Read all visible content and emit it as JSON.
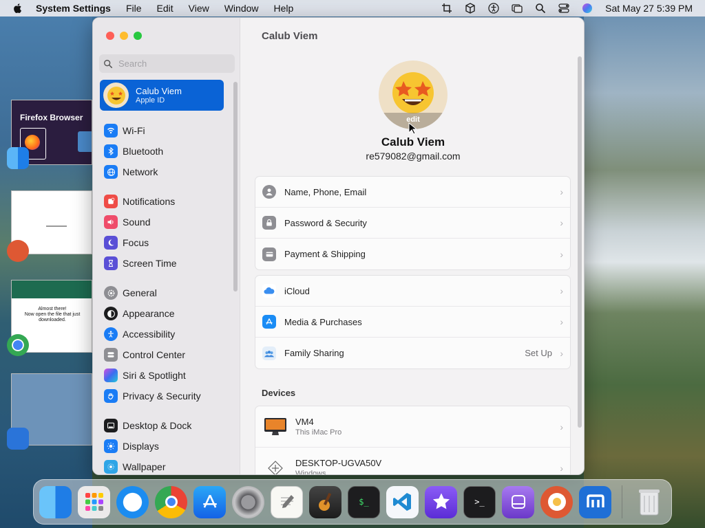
{
  "menubar": {
    "app_name": "System Settings",
    "menus": [
      "File",
      "Edit",
      "View",
      "Window",
      "Help"
    ],
    "clock": "Sat May 27  5:39 PM"
  },
  "desktop_thumbnails": {
    "firefox_title": "Firefox Browser",
    "firefox_msg_1": "Almost there!",
    "firefox_msg_2": "Now open the file that just downloaded."
  },
  "sidebar": {
    "search_placeholder": "Search",
    "account": {
      "name": "Calub Viem",
      "subtitle": "Apple ID"
    },
    "items": [
      {
        "label": "Wi-Fi",
        "color": "#1a7cf5",
        "icon": "wifi-icon"
      },
      {
        "label": "Bluetooth",
        "color": "#1a7cf5",
        "icon": "bluetooth-icon"
      },
      {
        "label": "Network",
        "color": "#1a7cf5",
        "icon": "globe-icon"
      },
      {
        "label": "Notifications",
        "color": "#ef4c47",
        "icon": "bell-icon"
      },
      {
        "label": "Sound",
        "color": "#ef4c6a",
        "icon": "speaker-icon"
      },
      {
        "label": "Focus",
        "color": "#5a4fd6",
        "icon": "moon-icon"
      },
      {
        "label": "Screen Time",
        "color": "#5a4fd6",
        "icon": "hourglass-icon"
      },
      {
        "label": "General",
        "color": "#8e8e93",
        "icon": "gear-icon"
      },
      {
        "label": "Appearance",
        "color": "#1c1c1e",
        "icon": "appearance-icon"
      },
      {
        "label": "Accessibility",
        "color": "#1a7cf5",
        "icon": "accessibility-icon"
      },
      {
        "label": "Control Center",
        "color": "#8e8e93",
        "icon": "control-center-icon"
      },
      {
        "label": "Siri & Spotlight",
        "color": "#9b3ed1",
        "icon": "siri-icon"
      },
      {
        "label": "Privacy & Security",
        "color": "#1a7cf5",
        "icon": "hand-icon"
      },
      {
        "label": "Desktop & Dock",
        "color": "#1c1c1e",
        "icon": "dock-icon"
      },
      {
        "label": "Displays",
        "color": "#1a7cf5",
        "icon": "sun-icon"
      },
      {
        "label": "Wallpaper",
        "color": "#2fa5e6",
        "icon": "wallpaper-icon"
      }
    ]
  },
  "content": {
    "title": "Calub Viem",
    "avatar_edit": "edit",
    "profile_name": "Calub Viem",
    "profile_email": "re579082@gmail.com",
    "group1": [
      {
        "label": "Name, Phone, Email",
        "icon": "person-icon"
      },
      {
        "label": "Password & Security",
        "icon": "lock-icon"
      },
      {
        "label": "Payment & Shipping",
        "icon": "card-icon"
      }
    ],
    "group2": [
      {
        "label": "iCloud",
        "icon": "cloud-icon"
      },
      {
        "label": "Media & Purchases",
        "icon": "app-store-icon"
      },
      {
        "label": "Family Sharing",
        "icon": "family-icon",
        "value": "Set Up"
      }
    ],
    "devices_header": "Devices",
    "devices": [
      {
        "name": "VM4",
        "subtitle": "This iMac Pro"
      },
      {
        "name": "DESKTOP-UGVA50V",
        "subtitle": "Windows"
      }
    ]
  },
  "dock": {
    "apps": [
      "Finder",
      "Launchpad",
      "Safari",
      "Chrome",
      "App Store",
      "System Settings",
      "TextEdit",
      "GarageBand",
      "Terminal Server",
      "Visual Studio Code",
      "iMovie",
      "Terminal",
      "Apple Configurator",
      "DuckDuckGo",
      "Maxthon",
      "Trash"
    ]
  }
}
